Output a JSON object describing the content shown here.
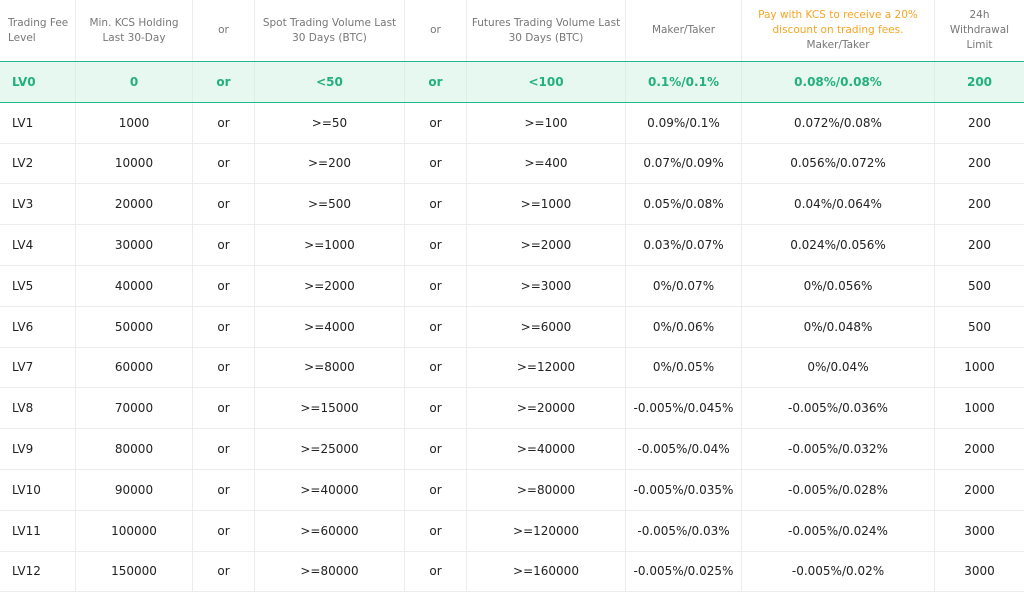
{
  "headers": {
    "level": "Trading Fee Level",
    "kcs": "Min. KCS Holding Last 30-Day",
    "or1": "or",
    "spot": "Spot Trading Volume Last 30 Days (BTC)",
    "or2": "or",
    "futures": "Futures Trading Volume Last 30 Days (BTC)",
    "maker_taker": "Maker/Taker",
    "discount_note": "Pay with KCS to receive a 20% discount on trading fees.",
    "discount_maker_taker": "Maker/Taker",
    "withdrawal": "24h Withdrawal Limit"
  },
  "colors": {
    "accent_green": "#22b07d",
    "highlight_bg": "#e6f8f0",
    "discount_orange": "#f5a623"
  },
  "rows": [
    {
      "level": "LV0",
      "kcs": "0",
      "or1": "or",
      "spot": "<50",
      "or2": "or",
      "futures": "<100",
      "fee": "0.1%/0.1%",
      "kcs_fee": "0.08%/0.08%",
      "limit": "200"
    },
    {
      "level": "LV1",
      "kcs": "1000",
      "or1": "or",
      "spot": ">=50",
      "or2": "or",
      "futures": ">=100",
      "fee": "0.09%/0.1%",
      "kcs_fee": "0.072%/0.08%",
      "limit": "200"
    },
    {
      "level": "LV2",
      "kcs": "10000",
      "or1": "or",
      "spot": ">=200",
      "or2": "or",
      "futures": ">=400",
      "fee": "0.07%/0.09%",
      "kcs_fee": "0.056%/0.072%",
      "limit": "200"
    },
    {
      "level": "LV3",
      "kcs": "20000",
      "or1": "or",
      "spot": ">=500",
      "or2": "or",
      "futures": ">=1000",
      "fee": "0.05%/0.08%",
      "kcs_fee": "0.04%/0.064%",
      "limit": "200"
    },
    {
      "level": "LV4",
      "kcs": "30000",
      "or1": "or",
      "spot": ">=1000",
      "or2": "or",
      "futures": ">=2000",
      "fee": "0.03%/0.07%",
      "kcs_fee": "0.024%/0.056%",
      "limit": "200"
    },
    {
      "level": "LV5",
      "kcs": "40000",
      "or1": "or",
      "spot": ">=2000",
      "or2": "or",
      "futures": ">=3000",
      "fee": "0%/0.07%",
      "kcs_fee": "0%/0.056%",
      "limit": "500"
    },
    {
      "level": "LV6",
      "kcs": "50000",
      "or1": "or",
      "spot": ">=4000",
      "or2": "or",
      "futures": ">=6000",
      "fee": "0%/0.06%",
      "kcs_fee": "0%/0.048%",
      "limit": "500"
    },
    {
      "level": "LV7",
      "kcs": "60000",
      "or1": "or",
      "spot": ">=8000",
      "or2": "or",
      "futures": ">=12000",
      "fee": "0%/0.05%",
      "kcs_fee": "0%/0.04%",
      "limit": "1000"
    },
    {
      "level": "LV8",
      "kcs": "70000",
      "or1": "or",
      "spot": ">=15000",
      "or2": "or",
      "futures": ">=20000",
      "fee": "-0.005%/0.045%",
      "kcs_fee": "-0.005%/0.036%",
      "limit": "1000"
    },
    {
      "level": "LV9",
      "kcs": "80000",
      "or1": "or",
      "spot": ">=25000",
      "or2": "or",
      "futures": ">=40000",
      "fee": "-0.005%/0.04%",
      "kcs_fee": "-0.005%/0.032%",
      "limit": "2000"
    },
    {
      "level": "LV10",
      "kcs": "90000",
      "or1": "or",
      "spot": ">=40000",
      "or2": "or",
      "futures": ">=80000",
      "fee": "-0.005%/0.035%",
      "kcs_fee": "-0.005%/0.028%",
      "limit": "2000"
    },
    {
      "level": "LV11",
      "kcs": "100000",
      "or1": "or",
      "spot": ">=60000",
      "or2": "or",
      "futures": ">=120000",
      "fee": "-0.005%/0.03%",
      "kcs_fee": "-0.005%/0.024%",
      "limit": "3000"
    },
    {
      "level": "LV12",
      "kcs": "150000",
      "or1": "or",
      "spot": ">=80000",
      "or2": "or",
      "futures": ">=160000",
      "fee": "-0.005%/0.025%",
      "kcs_fee": "-0.005%/0.02%",
      "limit": "3000"
    }
  ]
}
